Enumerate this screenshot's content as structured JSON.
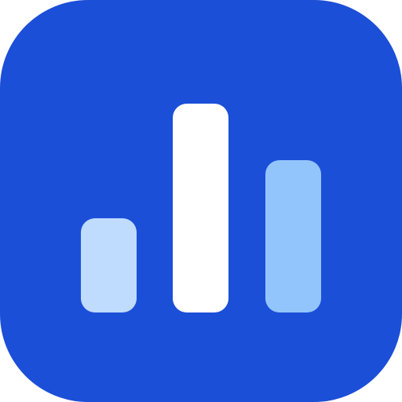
{
  "icon": {
    "name": "bar-chart-app-icon",
    "colors": {
      "tile": "#1C4FD8",
      "bar_left": "#BFDBFE",
      "bar_middle": "#FFFFFF",
      "bar_right": "#93C5FD"
    },
    "bars": [
      {
        "name": "left",
        "level": 0.45
      },
      {
        "name": "middle",
        "level": 1.0
      },
      {
        "name": "right",
        "level": 0.73
      }
    ]
  }
}
